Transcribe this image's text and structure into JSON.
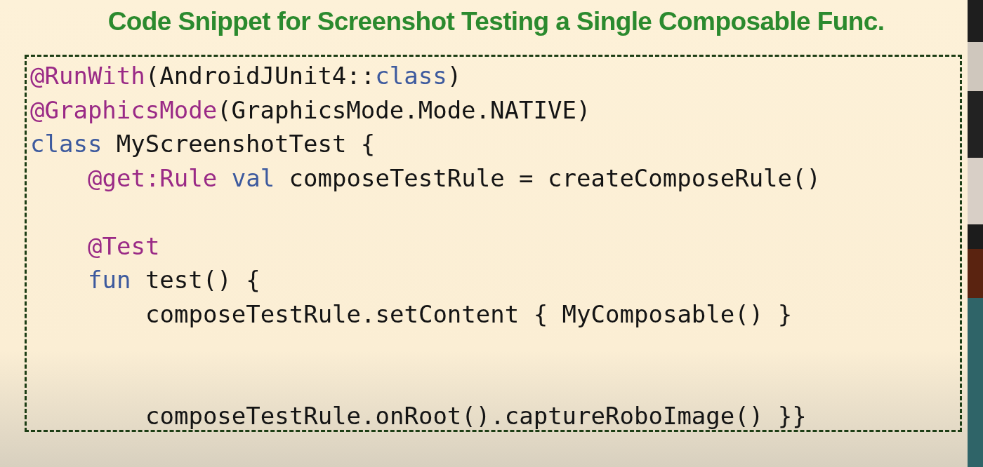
{
  "slide": {
    "title": "Code Snippet for Screenshot Testing a Single Composable Func.",
    "code_lines": [
      {
        "kind": "code",
        "tokens": [
          {
            "kind": "annotation",
            "text": "@RunWith"
          },
          {
            "kind": "plain",
            "text": "(AndroidJUnit4::"
          },
          {
            "kind": "keyword",
            "text": "class"
          },
          {
            "kind": "plain",
            "text": ")"
          }
        ]
      },
      {
        "kind": "code",
        "tokens": [
          {
            "kind": "annotation",
            "text": "@GraphicsMode"
          },
          {
            "kind": "plain",
            "text": "(GraphicsMode.Mode.NATIVE)"
          }
        ]
      },
      {
        "kind": "code",
        "tokens": [
          {
            "kind": "keyword",
            "text": "class"
          },
          {
            "kind": "plain",
            "text": " MyScreenshotTest {"
          }
        ],
        "children": [
          {
            "kind": "code",
            "tokens": [
              {
                "kind": "annotation",
                "text": "@get:Rule"
              },
              {
                "kind": "keyword",
                "text": " val"
              },
              {
                "kind": "plain",
                "text": " composeTestRule = createComposeRule()"
              }
            ]
          },
          {
            "kind": "blank"
          },
          {
            "kind": "code",
            "tokens": [
              {
                "kind": "annotation",
                "text": "@Test"
              }
            ]
          },
          {
            "kind": "code",
            "tokens": [
              {
                "kind": "keyword",
                "text": "fun"
              },
              {
                "kind": "plain",
                "text": " test() {"
              }
            ],
            "children": [
              {
                "kind": "code",
                "tokens": [
                  {
                    "kind": "plain",
                    "text": "composeTestRule.setContent { MyComposable() }"
                  }
                ]
              },
              {
                "kind": "blank"
              },
              {
                "kind": "blank"
              },
              {
                "kind": "code",
                "tokens": [
                  {
                    "kind": "plain",
                    "text": "composeTestRule.onRoot().captureRoboImage() }}"
                  }
                ]
              }
            ]
          }
        ]
      }
    ]
  }
}
